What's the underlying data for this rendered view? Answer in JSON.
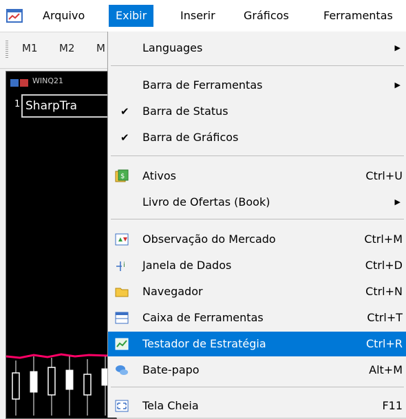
{
  "menubar": {
    "app_icon": "chart-window-icon",
    "items": [
      "Arquivo",
      "Exibir",
      "Inserir",
      "Gráficos",
      "Ferramentas"
    ],
    "active": "Exibir"
  },
  "toolbar": {
    "timeframes": [
      "M1",
      "M2",
      "M"
    ]
  },
  "chart": {
    "header": "WINQ21",
    "ea_prefix": "1",
    "ea_name": "SharpTra",
    "colors": {
      "background": "#000000",
      "candle": "#ffffff",
      "indicator": "#ff0066"
    }
  },
  "menu": {
    "languages": "Languages",
    "toolbars": "Barra de Ferramentas",
    "status_bar": "Barra de Status",
    "charts_bar": "Barra de Gráficos",
    "symbols": "Ativos",
    "symbols_sc": "Ctrl+U",
    "book": "Livro de Ofertas (Book)",
    "market_watch": "Observação do Mercado",
    "market_watch_sc": "Ctrl+M",
    "data_window": "Janela de Dados",
    "data_window_sc": "Ctrl+D",
    "navigator": "Navegador",
    "navigator_sc": "Ctrl+N",
    "toolbox": "Caixa de Ferramentas",
    "toolbox_sc": "Ctrl+T",
    "strategy_tester": "Testador de Estratégia",
    "strategy_tester_sc": "Ctrl+R",
    "chat": "Bate-papo",
    "chat_sc": "Alt+M",
    "fullscreen": "Tela Cheia",
    "fullscreen_sc": "F11",
    "check_glyph": "✔",
    "arrow_glyph": "▶"
  },
  "colors": {
    "accent": "#0078d7",
    "menu_bg": "#f2f2f2"
  }
}
